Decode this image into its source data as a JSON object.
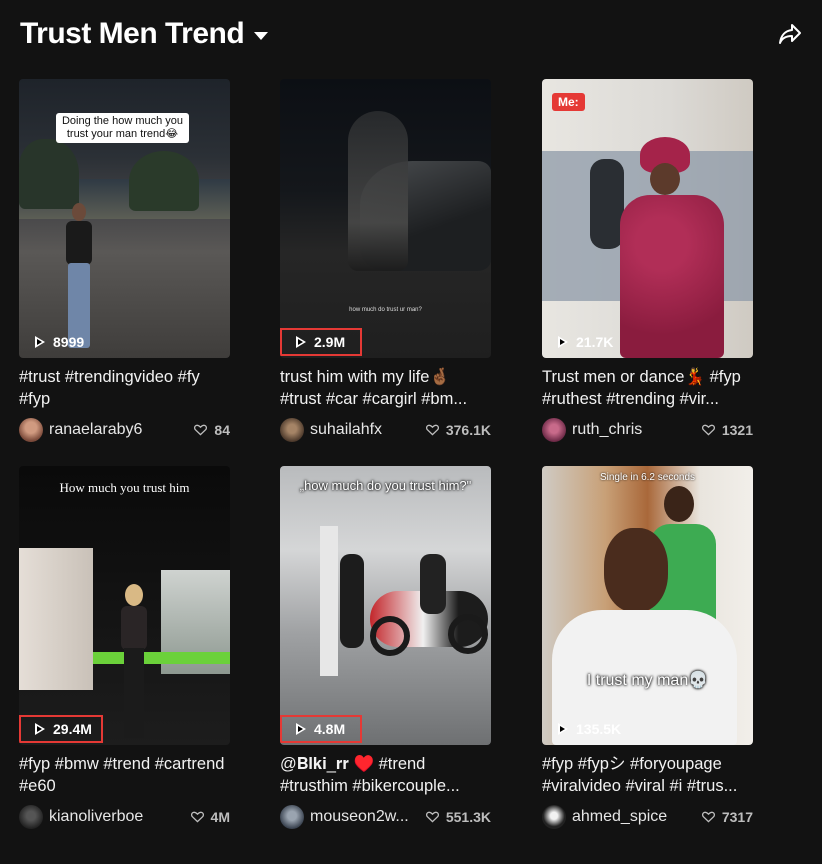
{
  "header": {
    "title": "Trust Men Trend"
  },
  "icons": {
    "dropdown": "caret-down-icon",
    "share": "share-arrow-icon",
    "play": "play-icon",
    "like": "heart-icon"
  },
  "colors": {
    "background": "#121212",
    "highlight_box": "#e53935"
  },
  "videos": [
    {
      "overlay": "Doing the how much you trust your man trend😂",
      "views": "8999",
      "caption": "#trust #trendingvideo #fy #fyp",
      "username": "ranaelaraby6",
      "likes": "84",
      "highlighted": false
    },
    {
      "overlay": "how much do trust ur man?",
      "views": "2.9M",
      "caption": "trust him with my life🤞🏾 #trust #car #cargirl #bm...",
      "username": "suhailahfx",
      "likes": "376.1K",
      "highlighted": true
    },
    {
      "overlay": "Me:",
      "views": "21.7K",
      "caption": "Trust men or dance💃 #fyp #ruthest #trending #vir...",
      "username": "ruth_chris",
      "likes": "1321",
      "highlighted": false
    },
    {
      "overlay": "How much you trust him",
      "views": "29.4M",
      "caption": "#fyp #bmw #trend #cartrend #e60",
      "username": "kianoliverboe",
      "likes": "4M",
      "highlighted": true
    },
    {
      "overlay": "„how much do you trust him?\"",
      "views": "4.8M",
      "caption": "@𝐁𝐥𝐤𝐢_𝐫𝐫 ♥️ #trend #trusthim #bikercouple...",
      "username": "mouseon2w...",
      "likes": "551.3K",
      "highlighted": true
    },
    {
      "overlay": "Single in 6.2 seconds",
      "overlay2": "I trust my man💀",
      "views": "135.5K",
      "caption": "#fyp #fypシ #foryoupage #viralvideo #viral #i #trus...",
      "username": "ahmed_spice",
      "likes": "7317",
      "highlighted": false
    }
  ]
}
